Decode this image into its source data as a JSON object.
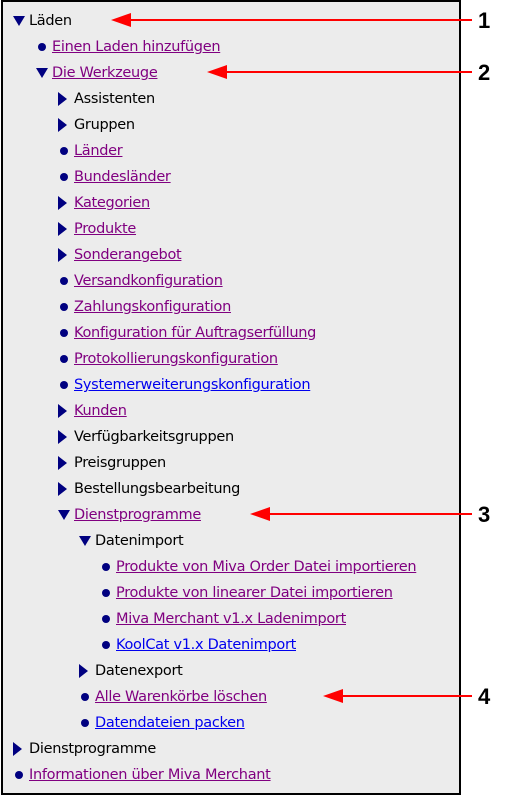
{
  "tree": [
    {
      "label": "Läden",
      "marker": "expanded",
      "style": "plain",
      "level": 0
    },
    {
      "label": "Einen Laden hinzufügen",
      "marker": "bullet",
      "style": "visited",
      "level": 1
    },
    {
      "label": "Die Werkzeuge",
      "marker": "expanded",
      "style": "visited",
      "level": 1
    },
    {
      "label": "Assistenten",
      "marker": "collapsed",
      "style": "plain",
      "level": 2
    },
    {
      "label": "Gruppen",
      "marker": "collapsed",
      "style": "plain",
      "level": 2
    },
    {
      "label": "Länder",
      "marker": "bullet",
      "style": "visited",
      "level": 2
    },
    {
      "label": "Bundesländer",
      "marker": "bullet",
      "style": "visited",
      "level": 2
    },
    {
      "label": "Kategorien",
      "marker": "collapsed",
      "style": "visited",
      "level": 2
    },
    {
      "label": "Produkte",
      "marker": "collapsed",
      "style": "visited",
      "level": 2
    },
    {
      "label": "Sonderangebot",
      "marker": "collapsed",
      "style": "visited",
      "level": 2
    },
    {
      "label": "Versandkonfiguration",
      "marker": "bullet",
      "style": "visited",
      "level": 2
    },
    {
      "label": "Zahlungskonfiguration",
      "marker": "bullet",
      "style": "visited",
      "level": 2
    },
    {
      "label": "Konfiguration für Auftragserfüllung",
      "marker": "bullet",
      "style": "visited",
      "level": 2
    },
    {
      "label": "Protokollierungskonfiguration",
      "marker": "bullet",
      "style": "visited",
      "level": 2
    },
    {
      "label": "Systemerweiterungskonfiguration",
      "marker": "bullet",
      "style": "unvisited",
      "level": 2
    },
    {
      "label": "Kunden",
      "marker": "collapsed",
      "style": "visited",
      "level": 2
    },
    {
      "label": "Verfügbarkeitsgruppen",
      "marker": "collapsed",
      "style": "plain",
      "level": 2
    },
    {
      "label": "Preisgruppen",
      "marker": "collapsed",
      "style": "plain",
      "level": 2
    },
    {
      "label": "Bestellungsbearbeitung",
      "marker": "collapsed",
      "style": "plain",
      "level": 2
    },
    {
      "label": "Dienstprogramme",
      "marker": "expanded",
      "style": "visited",
      "level": 2
    },
    {
      "label": "Datenimport",
      "marker": "expanded",
      "style": "plain",
      "level": 3
    },
    {
      "label": "Produkte von Miva Order Datei importieren",
      "marker": "bullet",
      "style": "visited",
      "level": 4
    },
    {
      "label": "Produkte von linearer Datei importieren",
      "marker": "bullet",
      "style": "visited",
      "level": 4
    },
    {
      "label": "Miva Merchant v1.x Ladenimport",
      "marker": "bullet",
      "style": "visited",
      "level": 4
    },
    {
      "label": "KoolCat v1.x Datenimport",
      "marker": "bullet",
      "style": "unvisited",
      "level": 4
    },
    {
      "label": "Datenexport",
      "marker": "collapsed",
      "style": "plain",
      "level": 3
    },
    {
      "label": "Alle Warenkörbe löschen",
      "marker": "bullet",
      "style": "visited",
      "level": 3
    },
    {
      "label": "Datendateien packen",
      "marker": "bullet",
      "style": "unvisited",
      "level": 3
    },
    {
      "label": "Dienstprogramme",
      "marker": "collapsed",
      "style": "plain",
      "level": 0
    },
    {
      "label": "Informationen über Miva Merchant",
      "marker": "bullet",
      "style": "visited",
      "level": 0
    }
  ],
  "callouts": [
    {
      "number": "1",
      "row": 0
    },
    {
      "number": "2",
      "row": 2
    },
    {
      "number": "3",
      "row": 19
    },
    {
      "number": "4",
      "row": 26
    }
  ],
  "colors": {
    "visited": "#800080",
    "unvisited": "#0000ee",
    "marker": "#000080",
    "arrow": "#ff0000"
  }
}
